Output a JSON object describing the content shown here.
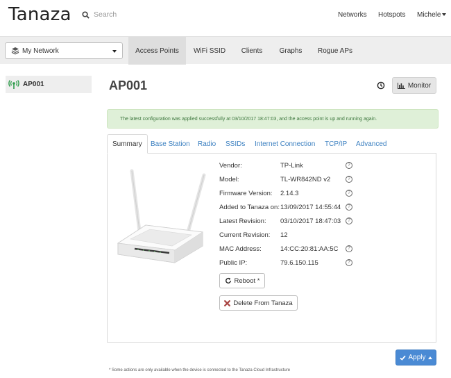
{
  "app": {
    "logo": "Tanaza"
  },
  "search": {
    "placeholder": "Search"
  },
  "topnav": {
    "networks": "Networks",
    "hotspots": "Hotspots",
    "user": "Michele"
  },
  "network_select": {
    "value": "My Network"
  },
  "subnav": [
    "Access Points",
    "WiFi SSID",
    "Clients",
    "Graphs",
    "Rogue APs"
  ],
  "sidebar": {
    "items": [
      {
        "label": "AP001",
        "icon": "wifi-signal-icon"
      }
    ]
  },
  "main": {
    "title": "AP001",
    "monitor_label": "Monitor",
    "alert": "The latest configuration was applied successfully at 03/10/2017 18:47:03, and the access point is up and running again.",
    "tabs": [
      "Summary",
      "Base Station",
      "Radio",
      "SSIDs",
      "Internet Connection",
      "TCP/IP",
      "Advanced"
    ],
    "summary": [
      {
        "label": "Vendor:",
        "value": "TP-Link",
        "help": true
      },
      {
        "label": "Model:",
        "value": "TL-WR842ND v2",
        "help": true
      },
      {
        "label": "Firmware Version:",
        "value": "2.14.3",
        "help": true
      },
      {
        "label": "Added to Tanaza on:",
        "value": "13/09/2017 14:55:44",
        "help": true
      },
      {
        "label": "Latest Revision:",
        "value": "03/10/2017 18:47:03",
        "help": true
      },
      {
        "label": "Current Revision:",
        "value": "12",
        "help": false
      },
      {
        "label": "MAC Address:",
        "value": "14:CC:20:81:AA:5C",
        "help": true
      },
      {
        "label": "Public IP:",
        "value": "79.6.150.115",
        "help": true
      }
    ],
    "reboot_label": "Reboot *",
    "delete_label": "Delete From Tanaza",
    "apply_label": "Apply",
    "footnote": "* Some actions are only available when the device is connected to the Tanaza Cloud Infrastructure"
  },
  "colors": {
    "accent": "#4a8ad4",
    "link": "#3a7fc0",
    "success_bg": "#dff0d8",
    "success_text": "#3c763d",
    "danger": "#a94442"
  }
}
